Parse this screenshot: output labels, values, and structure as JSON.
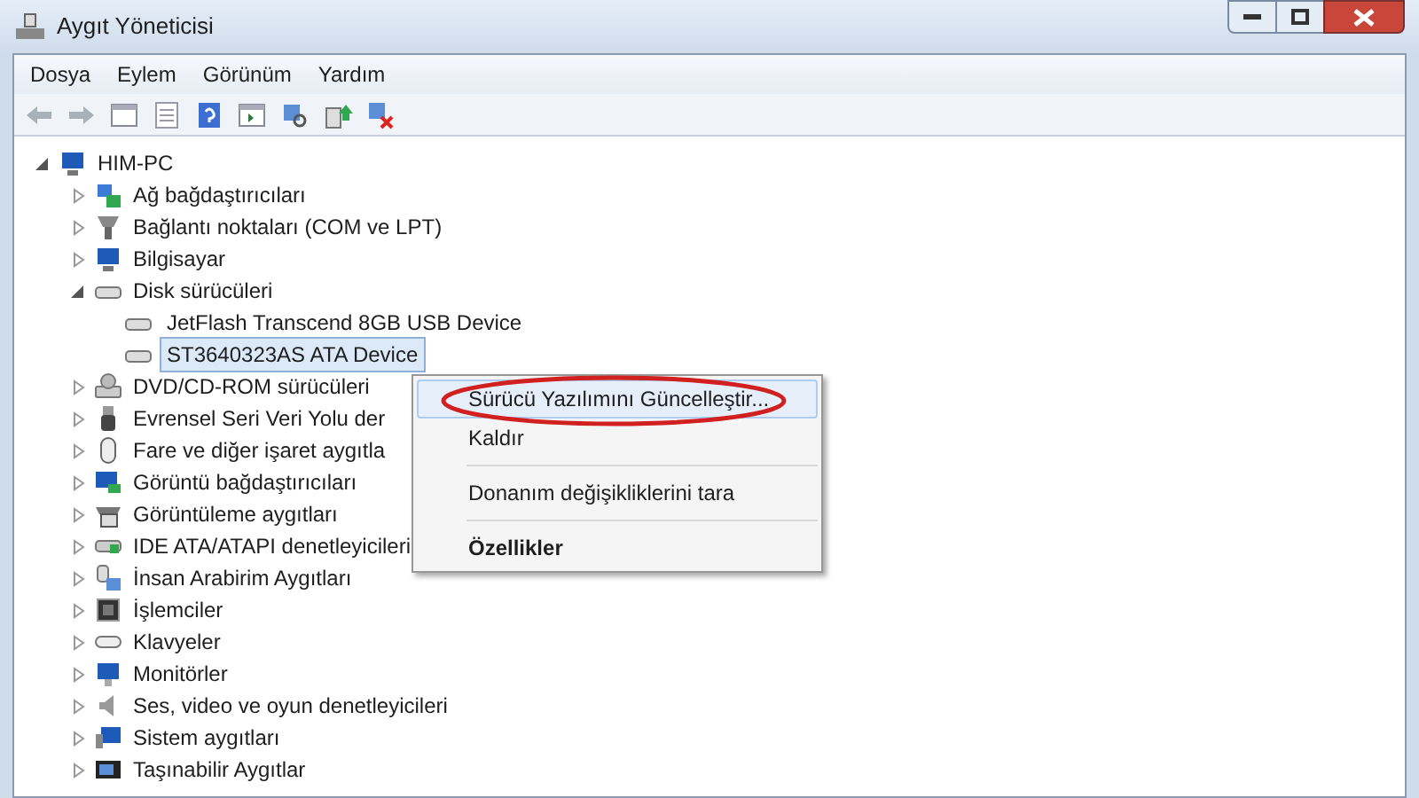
{
  "window": {
    "title": "Aygıt Yöneticisi"
  },
  "menu_bar": [
    "Dosya",
    "Eylem",
    "Görünüm",
    "Yardım"
  ],
  "tree": {
    "label": "HIM-PC",
    "expanded": true,
    "children": [
      {
        "label": "Ağ bağdaştırıcıları",
        "expanded": false
      },
      {
        "label": "Bağlantı noktaları (COM ve LPT)",
        "expanded": false
      },
      {
        "label": "Bilgisayar",
        "expanded": false
      },
      {
        "label": "Disk sürücüleri",
        "expanded": true,
        "children": [
          {
            "label": "JetFlash Transcend 8GB USB Device",
            "selected": false
          },
          {
            "label": "ST3640323AS ATA Device",
            "selected": true
          }
        ]
      },
      {
        "label": "DVD/CD-ROM sürücüleri",
        "expanded": false
      },
      {
        "label": "Evrensel Seri Veri Yolu der",
        "expanded": false
      },
      {
        "label": "Fare ve diğer işaret aygıtla",
        "expanded": false
      },
      {
        "label": "Görüntü bağdaştırıcıları",
        "expanded": false
      },
      {
        "label": "Görüntüleme aygıtları",
        "expanded": false
      },
      {
        "label": "IDE ATA/ATAPI denetleyicileri",
        "expanded": false
      },
      {
        "label": "İnsan Arabirim Aygıtları",
        "expanded": false
      },
      {
        "label": "İşlemciler",
        "expanded": false
      },
      {
        "label": "Klavyeler",
        "expanded": false
      },
      {
        "label": "Monitörler",
        "expanded": false
      },
      {
        "label": "Ses, video ve oyun denetleyicileri",
        "expanded": false
      },
      {
        "label": "Sistem aygıtları",
        "expanded": false
      },
      {
        "label": "Taşınabilir Aygıtlar",
        "expanded": false
      }
    ]
  },
  "context_menu": [
    {
      "label": "Sürücü Yazılımını Güncelleştir...",
      "selected": true,
      "bold": false,
      "circled": true
    },
    {
      "label": "Kaldır",
      "selected": false,
      "bold": false,
      "circled": false
    },
    {
      "label": "Donanım değişikliklerini tara",
      "selected": false,
      "bold": false,
      "circled": false
    },
    {
      "label": "Özellikler",
      "selected": false,
      "bold": true,
      "circled": false
    }
  ]
}
